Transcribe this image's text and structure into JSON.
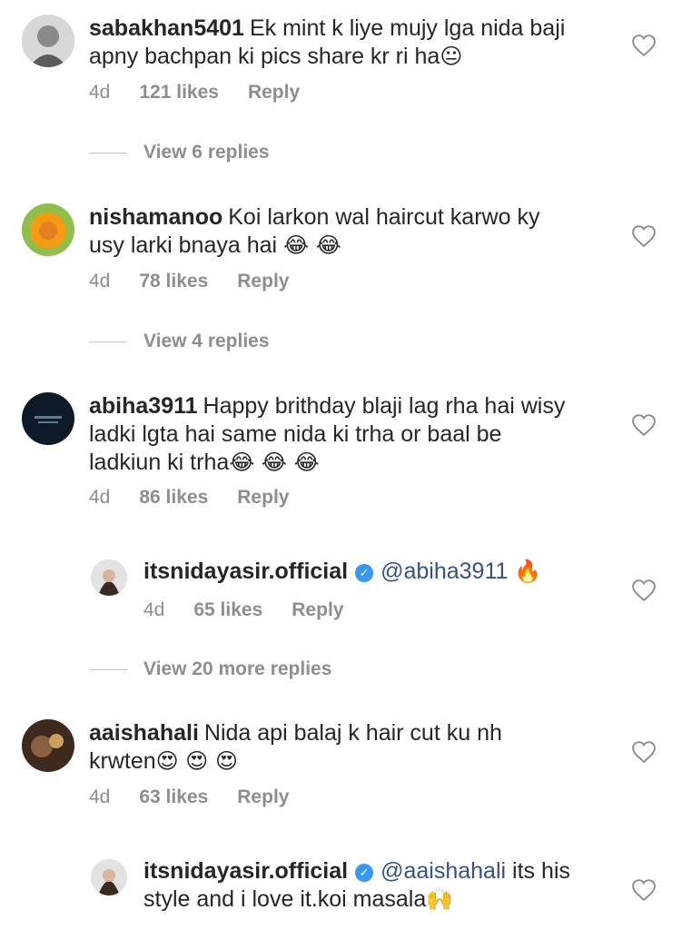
{
  "comments": [
    {
      "username": "sabakhan5401",
      "text_line1": "Ek mint k liye mujy lga nida baji",
      "text_line2": "apny bachpan ki pics share kr ri ha",
      "emoji": "😐",
      "time": "4d",
      "likes": "121 likes",
      "reply": "Reply",
      "view_replies": "View 6 replies",
      "avatar_color": "#b9b9b9"
    },
    {
      "username": "nishamanoo",
      "text_line1": "Koi larkon wal haircut karwo ky",
      "text_line2": "usy larki bnaya hai",
      "emoji": "😂 😂",
      "time": "4d",
      "likes": "78 likes",
      "reply": "Reply",
      "view_replies": "View 4 replies",
      "avatar_color": "#f4a219"
    },
    {
      "username": "abiha3911",
      "text_line1": "Happy brithday blaji lag rha hai wisy",
      "text_line2": "ladki lgta hai same nida ki trha or baal be",
      "text_line3": "ladkiun ki trha",
      "emoji": "😂 😂 😂",
      "time": "4d",
      "likes": "86 likes",
      "reply": "Reply",
      "avatar_color": "#0f1a28"
    },
    {
      "username": "itsnidayasir.official",
      "mention": "@abiha3911",
      "emoji": "🔥",
      "time": "4d",
      "likes": "65 likes",
      "reply": "Reply",
      "view_replies": "View 20 more replies",
      "avatar_color": "#cfcfcf"
    },
    {
      "username": "aaishahali",
      "text_line1": "Nida api balaj k hair cut ku nh",
      "text_line2": "krwten",
      "emoji": "😍 😍 😍",
      "time": "4d",
      "likes": "63 likes",
      "reply": "Reply",
      "avatar_color": "#4a3424"
    },
    {
      "username": "itsnidayasir.official",
      "mention": "@aaishahali",
      "text_line1": "its his",
      "text_line2": "style and i love it.koi masala",
      "emoji": "🙌",
      "avatar_color": "#cfcfcf"
    }
  ]
}
